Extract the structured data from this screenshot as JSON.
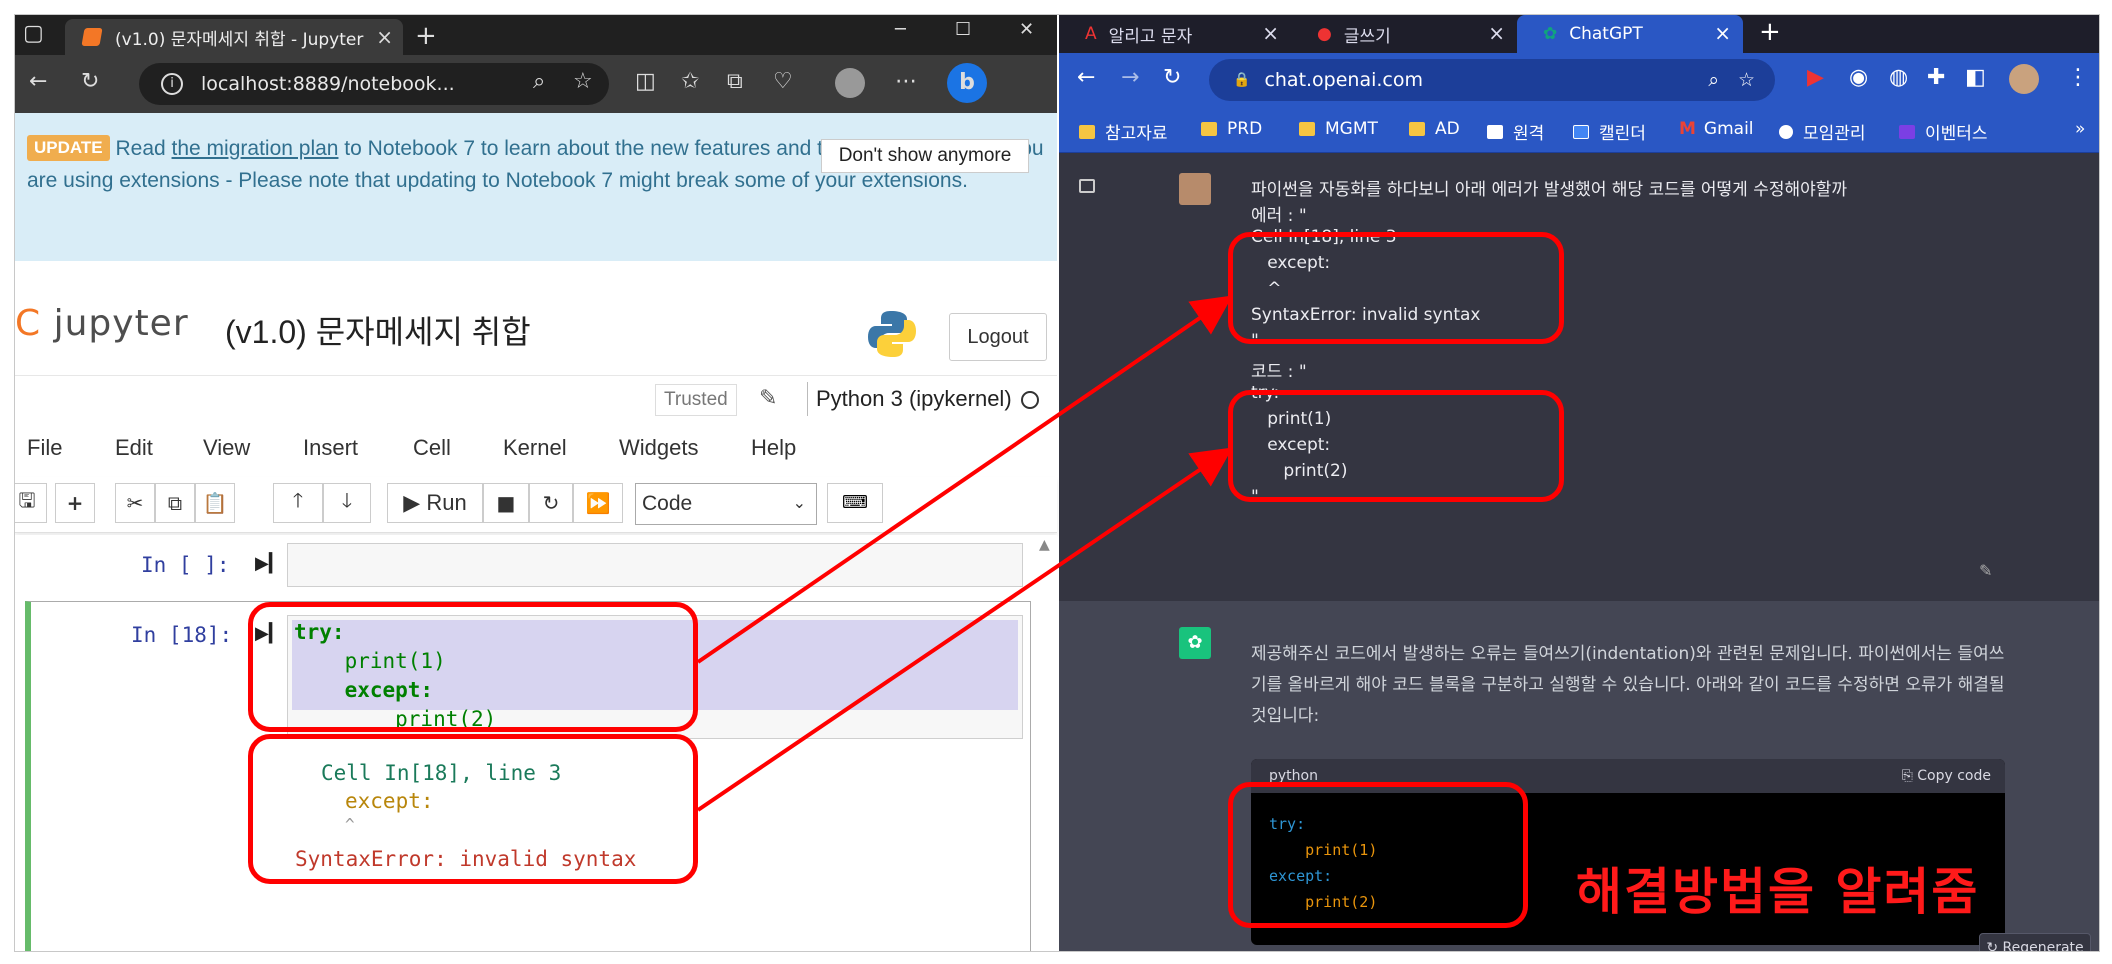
{
  "edge": {
    "tab_title": "(v1.0) 문자메세지 취합 - Jupyter",
    "url": "localhost:8889/notebook...",
    "window_controls": [
      "minimize-icon",
      "maximize-icon",
      "close-icon"
    ]
  },
  "jupyter": {
    "update_badge": "UPDATE",
    "update_text_1": "Read ",
    "update_link": "the migration plan",
    "update_text_2": " to Notebook 7 to learn about the new features and the actions to take if you are using extensions - Please note that updating to Notebook 7 might break some of your extensions.",
    "dont_show": "Don't show anymore",
    "logo": "jupyter",
    "notebook_title": "(v1.0) 문자메세지 취합",
    "logout": "Logout",
    "trusted": "Trusted",
    "kernel": "Python 3 (ipykernel)",
    "menu": [
      "File",
      "Edit",
      "View",
      "Insert",
      "Cell",
      "Kernel",
      "Widgets",
      "Help"
    ],
    "run_label": "Run",
    "cell_type": "Code",
    "empty_prompt": "In [ ]:",
    "cell_prompt": "In [18]:",
    "code_lines": [
      "try:",
      "    print(1)",
      "    except:",
      "        print(2)"
    ],
    "error_lines": [
      "Cell In[18], line 3",
      "except:",
      "^",
      "SyntaxError: invalid syntax"
    ]
  },
  "chrome": {
    "tabs": [
      "알리고 문자",
      "글쓰기",
      "ChatGPT"
    ],
    "url": "chat.openai.com",
    "bookmarks": [
      "참고자료",
      "PRD",
      "MGMT",
      "AD",
      "원격",
      "캘린더",
      "Gmail",
      "모임관리",
      "이벤터스"
    ]
  },
  "chatgpt": {
    "user_question": "파이썬을 자동화를 하다보니 아래 에러가 발생했어 해당 코드를 어떻게 수정해야할까",
    "user_lines": [
      "에러 : \"",
      "Cell In[18], line 3",
      "   except:",
      "   ^",
      "SyntaxError: invalid syntax",
      "\"",
      "코드 : \"",
      "try:",
      "   print(1)",
      "   except:",
      "      print(2)",
      "\""
    ],
    "bot_text": "제공해주신 코드에서 발생하는 오류는 들여쓰기(indentation)와 관련된 문제입니다. 파이썬에서는 들여쓰기를 올바르게 해야 코드 블록을 구분하고 실행할 수 있습니다. 아래와 같이 코드를 수정하면 오류가 해결될 것입니다:",
    "code_lang": "python",
    "copy_code": "Copy code",
    "fixed_code": [
      "try:",
      "    print(1)",
      "except:",
      "    print(2)"
    ],
    "regenerate": "Regenerate"
  },
  "annotation": {
    "caption": "해결방법을 알려줌",
    "color": "#ff0000"
  }
}
